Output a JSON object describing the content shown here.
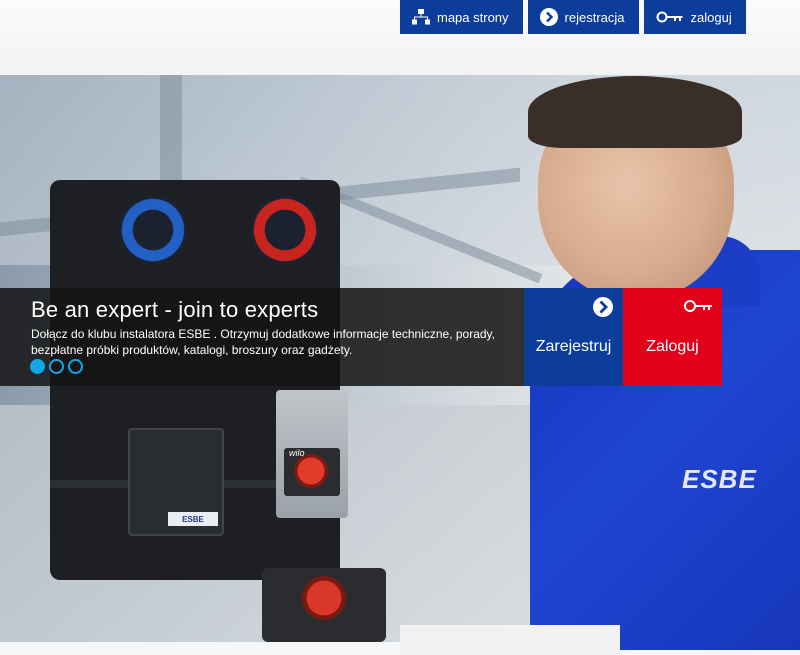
{
  "topnav": {
    "sitemap": {
      "label": "mapa strony",
      "icon": "sitemap-icon"
    },
    "register": {
      "label": "rejestracja",
      "icon": "chevron-right-circle-icon"
    },
    "login": {
      "label": "zaloguj",
      "icon": "key-icon"
    }
  },
  "banner": {
    "title": "Be an expert - join to experts",
    "description": "Dołącz do klubu instalatora ESBE . Otrzymuj dodatkowe informacje techniczne, porady, bezpłatne próbki produktów, katalogi, broszury oraz gadżety.",
    "slides": [
      {
        "active": true
      },
      {
        "active": false
      },
      {
        "active": false
      }
    ]
  },
  "cta": {
    "register": {
      "label": "Zarejestruj",
      "icon": "chevron-right-circle-icon"
    },
    "login": {
      "label": "Zaloguj",
      "icon": "key-icon"
    }
  },
  "photo": {
    "product_label": "ESBE",
    "pump_brand": "wilo",
    "shirt_logo": "ESBE"
  },
  "colors": {
    "brand_blue": "#0d3d9a",
    "brand_red": "#e2001a",
    "dot_blue": "#11a8e8"
  }
}
